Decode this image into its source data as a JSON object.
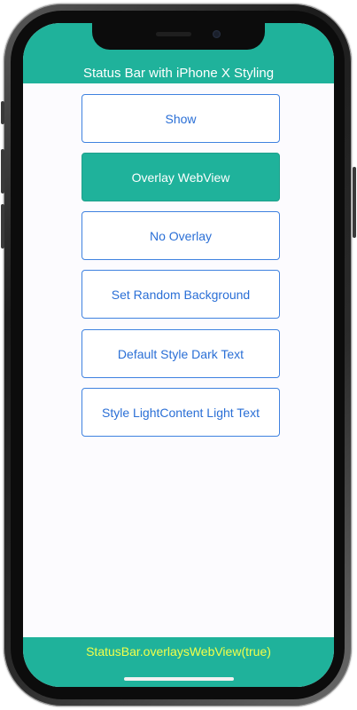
{
  "header": {
    "title": "Status Bar with iPhone X Styling"
  },
  "buttons": [
    {
      "label": "Show",
      "active": false
    },
    {
      "label": "Overlay WebView",
      "active": true
    },
    {
      "label": "No Overlay",
      "active": false
    },
    {
      "label": "Set Random Background",
      "active": false
    },
    {
      "label": "Default Style Dark Text",
      "active": false
    },
    {
      "label": "Style LightContent Light Text",
      "active": false
    }
  ],
  "footer": {
    "status": "StatusBar.overlaysWebView(true)"
  },
  "colors": {
    "accent": "#1fb29b",
    "button_border": "#3f82e0",
    "button_text": "#2a6fd6",
    "footer_text": "#f2ff4a",
    "screen_background": "#fcfbfe"
  }
}
